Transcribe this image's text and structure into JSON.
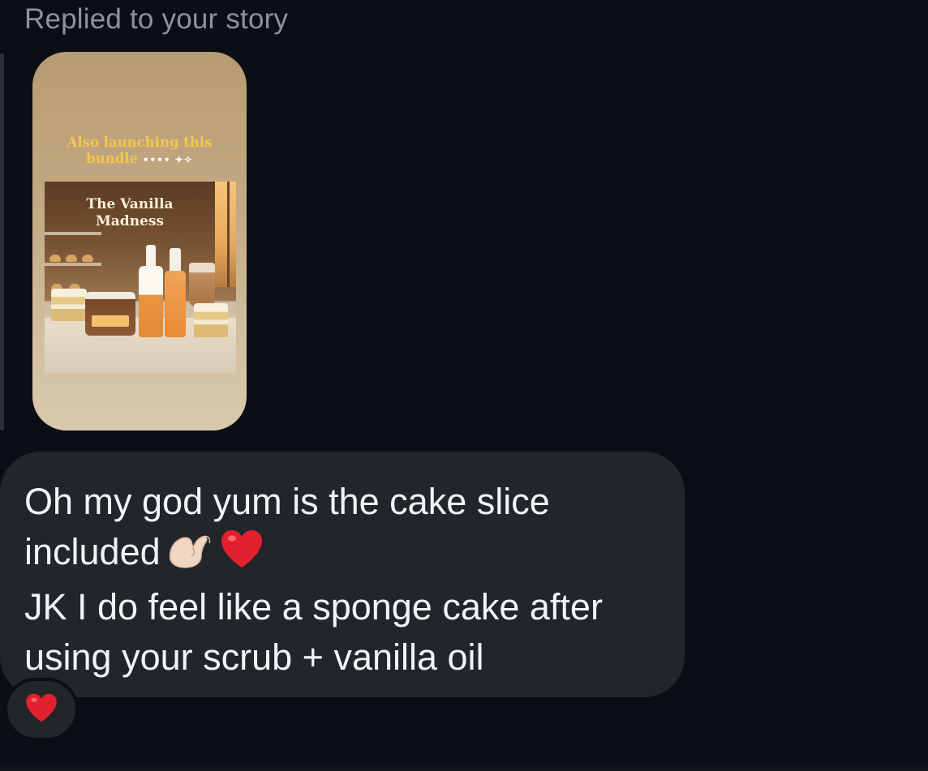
{
  "reply_label": "Replied to your story",
  "story": {
    "caption_text": "Also launching this bundle",
    "caption_deco": "•••• ✦✧",
    "photo_title": "The Vanilla Madness"
  },
  "message": {
    "line1": "Oh my god yum is the cake slice",
    "line2": "included",
    "line3": "JK I do feel like a sponge cake after",
    "line4": "using your scrub + vanilla oil",
    "emojis": [
      "pinching-hand-icon",
      "red-heart-icon"
    ]
  },
  "reaction": {
    "icon": "red-heart-icon"
  },
  "colors": {
    "background": "#0b0e14",
    "bubble": "#222529",
    "text": "#f2f3f5",
    "muted_text": "#8e939b",
    "heart": "#e3202d",
    "caption": "#f5c64d"
  }
}
